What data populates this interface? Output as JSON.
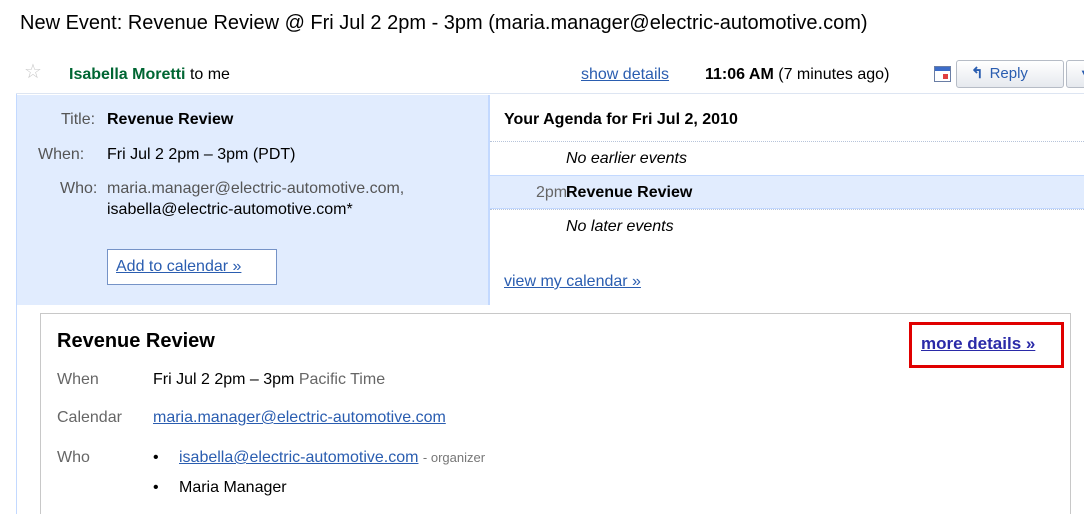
{
  "subject": "New Event: Revenue Review @ Fri Jul 2 2pm - 3pm (maria.manager@electric-automotive.com)",
  "message_header": {
    "sender_name": "Isabella Moretti",
    "recipient": "to me",
    "show_details": "show details",
    "time": "11:06 AM",
    "time_ago": "(7 minutes ago)",
    "reply_label": "Reply",
    "icons": [
      "star-icon",
      "calendar-icon",
      "reply-arrow-icon",
      "dropdown-arrow-icon"
    ]
  },
  "invitation": {
    "title_label": "Title:",
    "title_value": "Revenue Review",
    "when_label": "When:",
    "when_value": "Fri Jul 2 2pm – 3pm (PDT)",
    "who_label": "Who:",
    "who_line1": "maria.manager@electric-automotive.com,",
    "who_line2": "isabella@electric-automotive.com*",
    "add_to_calendar": "Add to calendar »"
  },
  "agenda": {
    "title": "Your Agenda for Fri Jul 2, 2010",
    "rows": [
      {
        "time": "",
        "event": "No earlier events"
      },
      {
        "time": "2pm",
        "event": "Revenue Review"
      },
      {
        "time": "",
        "event": "No later events"
      }
    ],
    "view_calendar": "view my calendar »"
  },
  "event_details": {
    "title": "Revenue Review",
    "more_details": "more details »",
    "when_label": "When",
    "when_value": "Fri Jul 2 2pm – 3pm",
    "when_tz": "Pacific Time",
    "calendar_label": "Calendar",
    "calendar_value": "maria.manager@electric-automotive.com",
    "who_label": "Who",
    "guests": [
      {
        "name": "isabella@electric-automotive.com",
        "role": "- organizer"
      },
      {
        "name": "Maria Manager",
        "role": ""
      }
    ],
    "bullet": "•"
  },
  "colors": {
    "sender": "#006633",
    "link": "#2a5db0",
    "invite_bg": "#e1ecfe",
    "highlight_border": "#e00000"
  }
}
